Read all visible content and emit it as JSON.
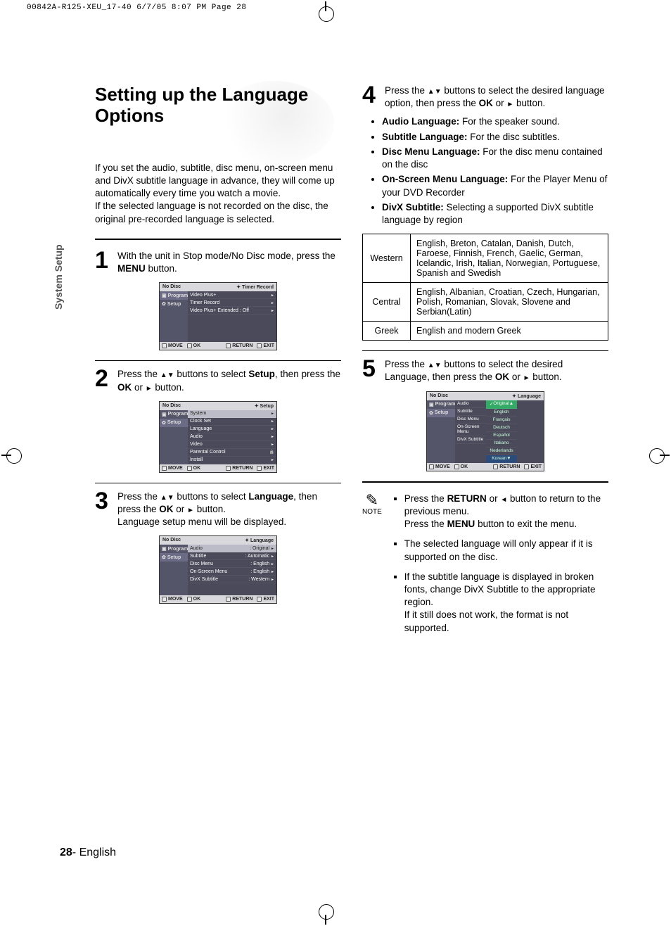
{
  "print_header": "00842A-R125-XEU_17-40  6/7/05  8:07 PM  Page 28",
  "side_tab": "System Setup",
  "title": "Setting up the Language Options",
  "intro1": "If you set the audio, subtitle, disc menu, on-screen menu and DivX subtitle language in advance, they will come up automatically every time you watch a movie.",
  "intro2": "If the selected language is not recorded on the disc, the original pre-recorded language is selected.",
  "steps": {
    "s1a": "With the unit in Stop mode/No Disc mode, press the ",
    "s1b": "MENU",
    "s1c": " button.",
    "s2a": "Press the ",
    "s2b": " buttons to select ",
    "s2c": "Setup",
    "s2d": ", then press the ",
    "s2e": "OK",
    "s2f": " or ",
    "s2g": " button.",
    "s3a": "Press the ",
    "s3b": " buttons to select ",
    "s3c": "Language",
    "s3d": ", then press the ",
    "s3e": "OK",
    "s3f": " or ",
    "s3g": " button.",
    "s3h": "Language setup menu will be displayed.",
    "s4a": "Press the ",
    "s4b": " buttons to select the desired language option, then press the ",
    "s4c": "OK",
    "s4d": " or ",
    "s4e": " button.",
    "s5a": "Press the ",
    "s5b": " buttons to select the  desired Language, then press the ",
    "s5c": "OK",
    "s5d": " or ",
    "s5e": " button."
  },
  "options": {
    "audio_b": "Audio Language:",
    "audio_t": " For the speaker sound.",
    "sub_b": "Subtitle Language:",
    "sub_t": " For the disc subtitles.",
    "disc_b": "Disc Menu Language:",
    "disc_t": " For the disc menu contained on the disc",
    "osm_b": "On-Screen Menu Language:",
    "osm_t": " For the Player Menu of your DVD Recorder",
    "divx_b": "DivX Subtitle:",
    "divx_t": " Selecting a supported DivX subtitle language by region"
  },
  "regions": {
    "r1l": "Western",
    "r1v": "English, Breton, Catalan, Danish, Dutch, Faroese, Finnish, French, Gaelic, German, Icelandic, Irish, Italian, Norwegian, Portuguese, Spanish and Swedish",
    "r2l": "Central",
    "r2v": "English, Albanian, Croatian, Czech, Hungarian, Polish, Romanian, Slovak, Slovene and Serbian(Latin)",
    "r3l": "Greek",
    "r3v": "English and modern Greek"
  },
  "note_label": "NOTE",
  "notes": {
    "n1a": "Press the ",
    "n1b": "RETURN",
    "n1c": " or ",
    "n1d": " button to return to the previous menu.",
    "n1e": "Press the ",
    "n1f": "MENU",
    "n1g": " button to exit the menu.",
    "n2": "The selected language will only appear if it is supported on the disc.",
    "n3a": "If the subtitle language is displayed in broken fonts, change DivX Subtitle to the appropriate region.",
    "n3b": "If it still does not work, the format is not supported."
  },
  "osd": {
    "no_disc": "No Disc",
    "programme": "Programme",
    "setup": "Setup",
    "timer_record_hdr": "Timer Record",
    "setup_hdr": "Setup",
    "language_hdr": "Language",
    "move": "MOVE",
    "ok": "OK",
    "return": "RETURN",
    "exit": "EXIT",
    "menu1": [
      "Video Plus+",
      "Timer Record",
      "Video Plus+ Extended : Off"
    ],
    "menu2": [
      "System",
      "Clock Set",
      "Language",
      "Audio",
      "Video",
      "Parental Control",
      "Install"
    ],
    "menu3": [
      {
        "l": "Audio",
        "v": ": Original",
        "sel": true
      },
      {
        "l": "Subtitle",
        "v": ": Automatic"
      },
      {
        "l": "Disc Menu",
        "v": ": English"
      },
      {
        "l": "On-Screen Menu",
        "v": ": English"
      },
      {
        "l": "DivX Subtitle",
        "v": ": Western"
      }
    ],
    "menu5_left": [
      "Audio",
      "Subtitle",
      "Disc Menu",
      "On-Screen Menu",
      "DivX Subtitle"
    ],
    "menu5_right": [
      "Original",
      "English",
      "Français",
      "Deutsch",
      "Español",
      "Italiano",
      "Nederlands",
      "Korean"
    ]
  },
  "footer_page": "28",
  "footer_lang": "- English"
}
